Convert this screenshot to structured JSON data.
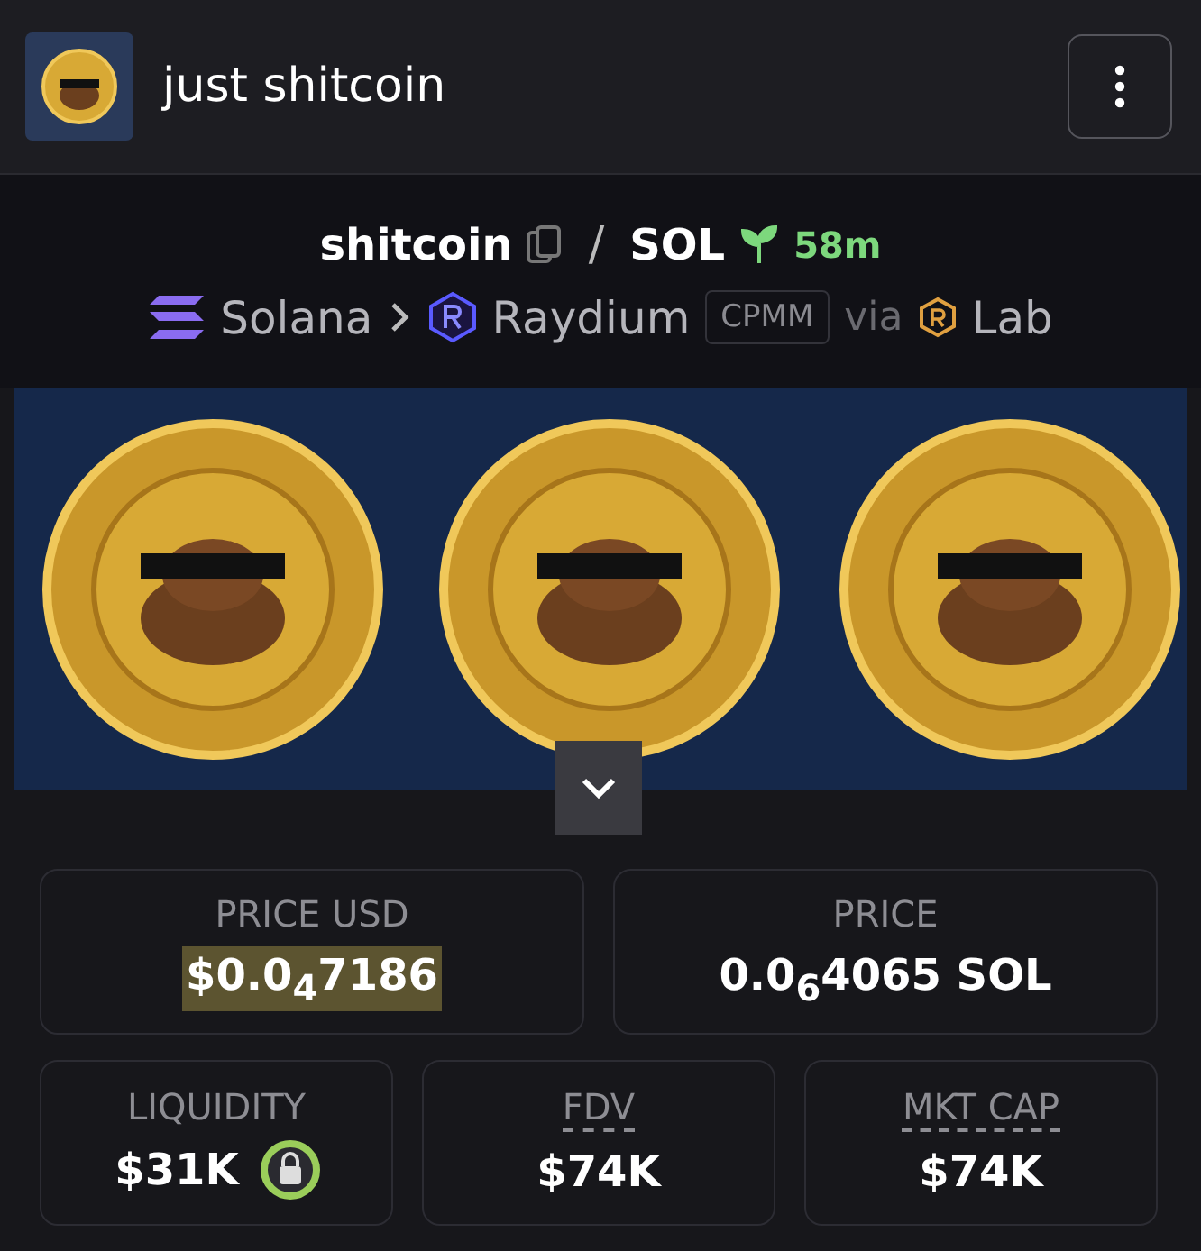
{
  "header": {
    "title": "just shitcoin"
  },
  "pair": {
    "base": "shitcoin",
    "separator": "/",
    "quote": "SOL",
    "age": "58m"
  },
  "route": {
    "chain": "Solana",
    "dex": "Raydium",
    "pool_type": "CPMM",
    "via": "via",
    "launchpad": "Lab"
  },
  "price_cards": [
    {
      "label": "PRICE USD",
      "value": "$0.0$_{4}$7186",
      "highlighted": true
    },
    {
      "label": "PRICE",
      "value": "0.0$_{6}$4065 SOL",
      "highlighted": false
    }
  ],
  "stat_cards": [
    {
      "label": "LIQUIDITY",
      "value": "$31K",
      "underlined": false,
      "locked": true
    },
    {
      "label": "FDV",
      "value": "$74K",
      "underlined": true,
      "locked": false
    },
    {
      "label": "MKT CAP",
      "value": "$74K",
      "underlined": true,
      "locked": false
    }
  ]
}
